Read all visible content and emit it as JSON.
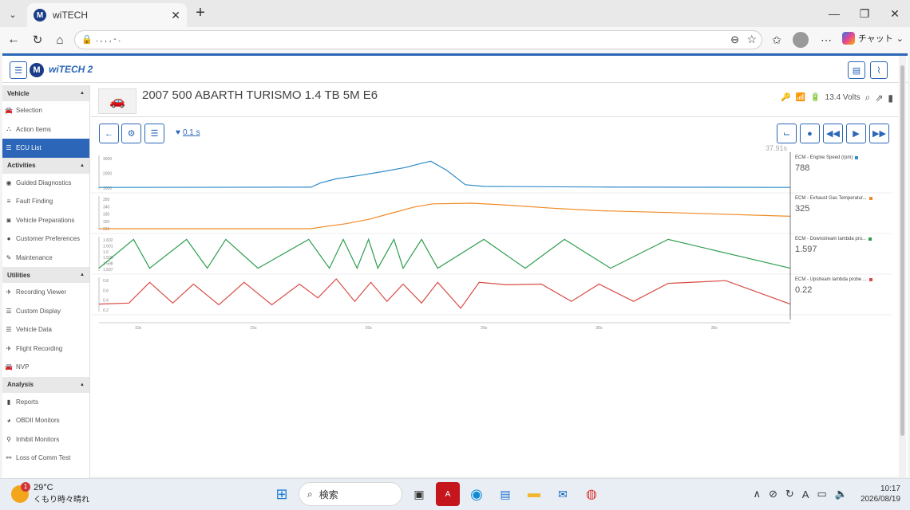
{
  "browser": {
    "tab_title": "wiTECH",
    "tab_close": "✕",
    "new_tab": "+",
    "address": ".   ,  ,  ,                              -  .",
    "chat_label": "チャット",
    "win_min": "—",
    "win_max": "❐",
    "win_close": "✕"
  },
  "app": {
    "logo_text": "wiTECH 2"
  },
  "sidebar": {
    "sections": [
      {
        "title": "Vehicle",
        "items": [
          {
            "label": "Selection",
            "icon": "car-icon"
          },
          {
            "label": "Action Items",
            "icon": "sitemap-icon"
          },
          {
            "label": "ECU List",
            "icon": "list-icon",
            "active": true
          }
        ]
      },
      {
        "title": "Activities",
        "items": [
          {
            "label": "Guided Diagnostics",
            "icon": "compass-icon"
          },
          {
            "label": "Fault Finding",
            "icon": "bars-icon"
          },
          {
            "label": "Vehicle Preparations",
            "icon": "car-front-icon"
          },
          {
            "label": "Customer Preferences",
            "icon": "user-icon"
          },
          {
            "label": "Maintenance",
            "icon": "wrench-icon"
          }
        ]
      },
      {
        "title": "Utilities",
        "items": [
          {
            "label": "Recording Viewer",
            "icon": "plane-icon"
          },
          {
            "label": "Custom Display",
            "icon": "list-icon"
          },
          {
            "label": "Vehicle Data",
            "icon": "list-icon"
          },
          {
            "label": "Flight Recording",
            "icon": "plane-icon"
          },
          {
            "label": "NVP",
            "icon": "car-icon"
          }
        ]
      },
      {
        "title": "Analysis",
        "items": [
          {
            "label": "Reports",
            "icon": "file-icon"
          },
          {
            "label": "OBDII Monitors",
            "icon": "gauge-icon"
          },
          {
            "label": "Inhibit Monitors",
            "icon": "network-icon"
          },
          {
            "label": "Loss of Comm Test",
            "icon": "link-icon"
          }
        ]
      }
    ]
  },
  "vehicle": {
    "title": "2007 500 ABARTH TURISMO 1.4 TB 5M E6",
    "voltage": "13.4 Volts"
  },
  "toolbar": {
    "interval": "0.1 s"
  },
  "recording": {
    "time": "37.91s"
  },
  "chart_data": {
    "type": "line",
    "x_ticks": [
      "10s",
      "15s",
      "20s",
      "25s",
      "30s",
      "35s"
    ],
    "series": [
      {
        "name": "ECM - Engine Speed (rpm)",
        "current": "788",
        "color": "#2f8bc9",
        "y_ticks": [
          "3000",
          "2000",
          "1000"
        ],
        "ylim": [
          800,
          4500
        ],
        "x": [
          8.3,
          17.5,
          17.9,
          18.6,
          19.6,
          20.6,
          21.6,
          22.3,
          22.7,
          23.4,
          24.2,
          25.0,
          30.0,
          38.3
        ],
        "y": [
          875,
          900,
          1400,
          1900,
          2300,
          2750,
          3250,
          3750,
          4000,
          2900,
          1200,
          1000,
          920,
          875
        ]
      },
      {
        "name": "ECM - Exhaust Gas Temperatur...",
        "current": "325",
        "color": "#f08a24",
        "y_ticks": [
          "350",
          "340",
          "330",
          "320",
          "310"
        ],
        "ylim": [
          305,
          355
        ],
        "x": [
          8.3,
          17.5,
          18.0,
          19.0,
          20.0,
          21.0,
          22.0,
          22.8,
          24.5,
          26.0,
          28.0,
          30.0,
          33.0,
          38.3
        ],
        "y": [
          305,
          305,
          308,
          313,
          320,
          330,
          340,
          345,
          346,
          343,
          338,
          334,
          331,
          325
        ]
      },
      {
        "name": "ECM - Downstream lambda pro...",
        "current": "1.597",
        "color": "#2e9e4e",
        "y_ticks": [
          "1.602",
          "1.601",
          "1.6",
          "1.599",
          "1.598",
          "1.597"
        ],
        "ylim": [
          1.5968,
          1.6022
        ],
        "x": [
          8.3,
          9.8,
          10.5,
          12.1,
          13.0,
          13.8,
          15.2,
          17.4,
          18.3,
          18.9,
          19.5,
          20.0,
          20.4,
          21.1,
          21.5,
          22.3,
          23.0,
          25.0,
          26.8,
          28.5,
          30.5,
          33.0,
          38.3
        ],
        "y": [
          1.597,
          1.602,
          1.597,
          1.602,
          1.597,
          1.602,
          1.597,
          1.602,
          1.597,
          1.602,
          1.597,
          1.602,
          1.597,
          1.602,
          1.597,
          1.602,
          1.597,
          1.602,
          1.597,
          1.602,
          1.597,
          1.602,
          1.597
        ]
      },
      {
        "name": "ECM - Upstream lambda probe ...",
        "current": "0.22",
        "color": "#d84c45",
        "y_ticks": [
          "0.8",
          "0.6",
          "0.4",
          "0.2"
        ],
        "ylim": [
          0.05,
          0.95
        ],
        "x": [
          8.3,
          9.6,
          10.5,
          11.5,
          12.4,
          13.5,
          14.6,
          15.8,
          17.0,
          17.8,
          18.6,
          19.4,
          20.1,
          20.8,
          21.5,
          22.3,
          23.0,
          24.0,
          24.8,
          26.0,
          27.5,
          28.8,
          30.0,
          31.5,
          33.0,
          35.5,
          38.3
        ],
        "y": [
          0.22,
          0.25,
          0.85,
          0.25,
          0.8,
          0.2,
          0.85,
          0.2,
          0.8,
          0.4,
          0.95,
          0.3,
          0.85,
          0.3,
          0.8,
          0.25,
          0.85,
          0.1,
          0.85,
          0.78,
          0.8,
          0.3,
          0.8,
          0.3,
          0.82,
          0.9,
          0.22
        ]
      }
    ],
    "xlim": [
      8.3,
      38.3
    ]
  },
  "taskbar": {
    "temp": "29°C",
    "condition": "くもり時々晴れ",
    "badge": "1",
    "search": "検索",
    "time": "10:17",
    "date": "2026/08/19"
  }
}
